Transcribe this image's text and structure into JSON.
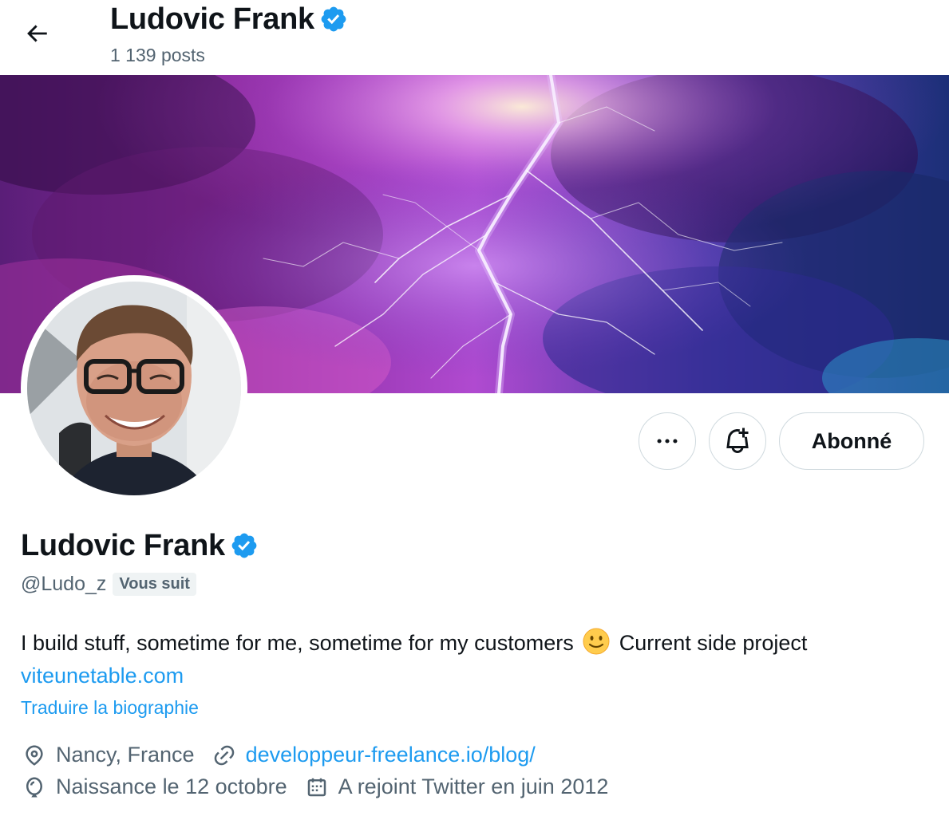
{
  "header": {
    "back_icon": "arrow-left-icon",
    "name": "Ludovic Frank",
    "posts": "1 139 posts",
    "verified_icon": "verified-badge-icon"
  },
  "actions": {
    "more_icon": "more-horizontal-icon",
    "notify_icon": "bell-plus-icon",
    "follow_label": "Abonné"
  },
  "profile": {
    "name": "Ludovic Frank",
    "handle": "@Ludo_z",
    "follows_you": "Vous suit",
    "bio_text": "I build stuff, sometime for me, sometime for my customers",
    "bio_emoji": "slightly-smiling-face-emoji",
    "bio_text_after": "Current side project",
    "bio_link": "viteunetable.com",
    "translate": "Traduire la biographie",
    "location": "Nancy, France",
    "website": "developpeur-freelance.io/blog/",
    "birthday": "Naissance le 12 octobre",
    "joined": "A rejoint Twitter en juin 2012"
  },
  "colors": {
    "accent": "#1d9bf0",
    "text": "#0f1419",
    "secondary": "#536471",
    "border": "#cfd9de",
    "verified": "#1d9bf0"
  }
}
